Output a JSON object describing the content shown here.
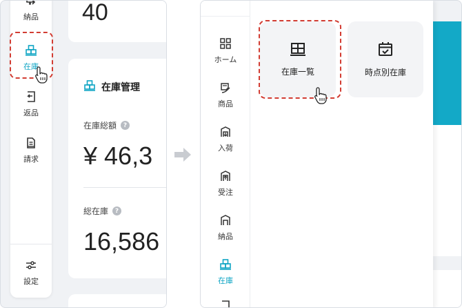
{
  "left_panel": {
    "sidebar": {
      "items": [
        {
          "label": "納品",
          "icon": "delivery-icon"
        },
        {
          "label": "在庫",
          "icon": "inventory-icon",
          "active": true
        },
        {
          "label": "返品",
          "icon": "return-icon"
        },
        {
          "label": "請求",
          "icon": "invoice-icon"
        },
        {
          "label": "設定",
          "icon": "settings-icon"
        }
      ]
    },
    "top_card": {
      "value": "40"
    },
    "inventory_card": {
      "title": "在庫管理",
      "total_amount_label": "在庫総額",
      "total_amount_value": "¥ 46,3",
      "total_stock_label": "総在庫",
      "total_stock_value": "16,586"
    }
  },
  "right_panel": {
    "sidebar": {
      "items": [
        {
          "label": "ホーム",
          "icon": "home-icon"
        },
        {
          "label": "商品",
          "icon": "product-icon"
        },
        {
          "label": "入荷",
          "icon": "inbound-icon"
        },
        {
          "label": "受注",
          "icon": "order-icon"
        },
        {
          "label": "納品",
          "icon": "delivery-icon"
        },
        {
          "label": "在庫",
          "icon": "inventory-icon",
          "active": true
        }
      ]
    },
    "submenu": [
      {
        "label": "在庫一覧",
        "icon": "grid-table-icon"
      },
      {
        "label": "時点別在庫",
        "icon": "calendar-check-icon"
      }
    ]
  },
  "colors": {
    "accent": "#0fa5c4",
    "highlight": "#d23c32",
    "teal_bar": "#13a9c7"
  }
}
